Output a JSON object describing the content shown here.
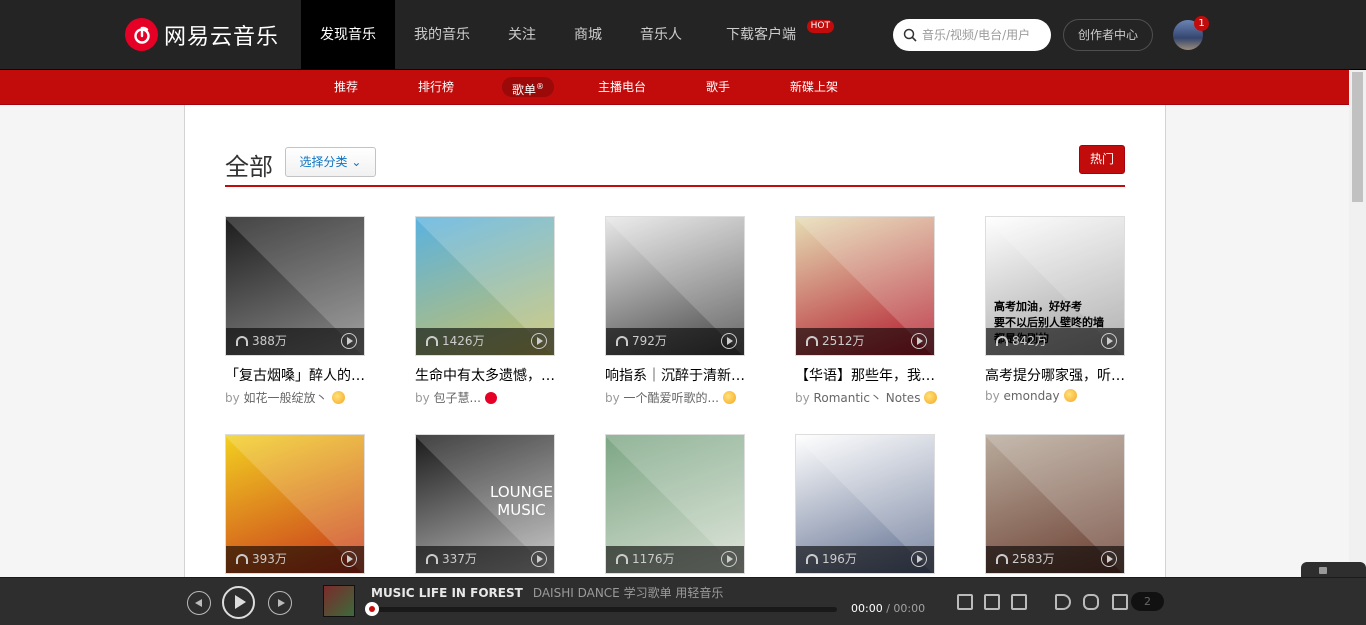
{
  "app": {
    "logo_text": "网易云音乐"
  },
  "header": {
    "nav": [
      {
        "label": "发现音乐",
        "active": true
      },
      {
        "label": "我的音乐"
      },
      {
        "label": "关注"
      },
      {
        "label": "商城"
      },
      {
        "label": "音乐人"
      },
      {
        "label": "下载客户端",
        "badge": "HOT"
      }
    ],
    "search": {
      "placeholder": "音乐/视频/电台/用户",
      "value": ""
    },
    "creator_label": "创作者中心",
    "notification_count": "1"
  },
  "subnav": {
    "items": [
      {
        "label": "推荐"
      },
      {
        "label": "排行榜"
      },
      {
        "label": "歌单",
        "mark": "®",
        "active": true
      },
      {
        "label": "主播电台"
      },
      {
        "label": "歌手"
      },
      {
        "label": "新碟上架"
      }
    ]
  },
  "section": {
    "title": "全部",
    "category_button": "选择分类",
    "category_chevron": "⌄",
    "hot_button": "热门"
  },
  "playlists": [
    {
      "name": "「复古烟嗓」醉人的…",
      "plays": "388万",
      "by_prefix": "by",
      "user": "如花一般绽放丶",
      "user_badge": "vip",
      "cover": [
        "#1c1c1c",
        "#8c8c8c"
      ]
    },
    {
      "name": "生命中有太多遗憾，…",
      "plays": "1426万",
      "by_prefix": "by",
      "user": "包子慧...",
      "user_badge": "music",
      "cover": [
        "#5ab2e0",
        "#c8c066"
      ]
    },
    {
      "name": "响指系｜沉醉于清新…",
      "plays": "792万",
      "by_prefix": "by",
      "user": "一个酷爱听歌的...",
      "user_badge": "vip",
      "cover": [
        "#e8e8e8",
        "#444444"
      ]
    },
    {
      "name": "【华语】那些年，我…",
      "plays": "2512万",
      "by_prefix": "by",
      "user": "Romantic丶 Notes",
      "user_badge": "vip",
      "cover": [
        "#e6ddb4",
        "#b2182b"
      ]
    },
    {
      "name": "高考提分哪家强，听…",
      "plays": "842万",
      "by_prefix": "by",
      "user": "emonday",
      "user_badge": "vip",
      "cover": [
        "#ffffff",
        "#9e9e9e"
      ],
      "overlay": "高考加油，好好考\n要不以后别人壁咚的墙\n都是你刷的"
    },
    {
      "name": "",
      "plays": "393万",
      "by_prefix": "",
      "user": "",
      "cover": [
        "#f2d021",
        "#c8341c"
      ]
    },
    {
      "name": "",
      "plays": "337万",
      "by_prefix": "",
      "user": "",
      "cover": [
        "#1a1a1a",
        "#bfbfbf"
      ],
      "overlay": "LOUNGE\nMUSIC"
    },
    {
      "name": "",
      "plays": "1176万",
      "by_prefix": "",
      "user": "",
      "cover": [
        "#7ca684",
        "#d7dfd2"
      ]
    },
    {
      "name": "",
      "plays": "196万",
      "by_prefix": "",
      "user": "",
      "cover": [
        "#ffffff",
        "#5e6d8f"
      ]
    },
    {
      "name": "",
      "plays": "2583万",
      "by_prefix": "",
      "user": "",
      "cover": [
        "#b9ab9c",
        "#6b3f32"
      ]
    }
  ],
  "player": {
    "song": "MUSIC LIFE IN FOREST",
    "artist": "DAISHI DANCE 学习歌单 用轻音乐",
    "current_time": "00:00",
    "total_time": "00:00",
    "separator": " / ",
    "queue_count": "2",
    "progress": 0
  },
  "colors": {
    "brand": "#c20c0c",
    "topbar": "#242424",
    "player": "#2e2e2e"
  }
}
